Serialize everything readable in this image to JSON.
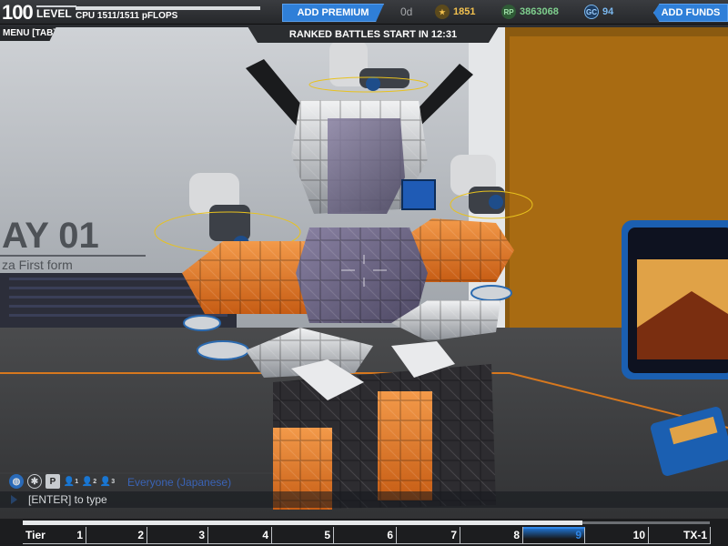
{
  "top_bar": {
    "level_number": "100",
    "level_label": "LEVEL",
    "cpu_label": "CPU 1511/1511 pFLOPS",
    "add_premium_label": "ADD PREMIUM",
    "premium_days": "0d",
    "stars_value": "1851",
    "rp_icon_text": "RP",
    "rp_value": "3863068",
    "gc_icon_text": "GC",
    "gc_value": "94",
    "add_funds_label": "ADD FUNDS"
  },
  "sub_bar": {
    "menu_label": "MENU [TAB]",
    "ranked_banner": "RANKED BATTLES START IN 12:31"
  },
  "scene": {
    "bay_sign": "AY 01",
    "bay_subtitle": "za First form"
  },
  "chat": {
    "icons": [
      "globe-icon",
      "faction-icon",
      "party-icon",
      "whisper-icon",
      "team-icon",
      "squad-icon"
    ],
    "party_glyph": "P",
    "whisper_count": "1",
    "team_count": "2",
    "squad_count": "3",
    "channel_label": "Everyone (Japanese)",
    "input_hint": "[ENTER] to type"
  },
  "tier_bar": {
    "tiers": [
      "Tier",
      "1",
      "2",
      "3",
      "4",
      "5",
      "6",
      "7",
      "8",
      "9",
      "10",
      "TX-1"
    ],
    "active_tier": "9"
  },
  "colors": {
    "accent_blue": "#2f7fd8",
    "premium_gold": "#f2c14e",
    "rp_green": "#7fd08e",
    "gc_blue": "#7ab7ee",
    "robot_orange": "#e8741e"
  }
}
